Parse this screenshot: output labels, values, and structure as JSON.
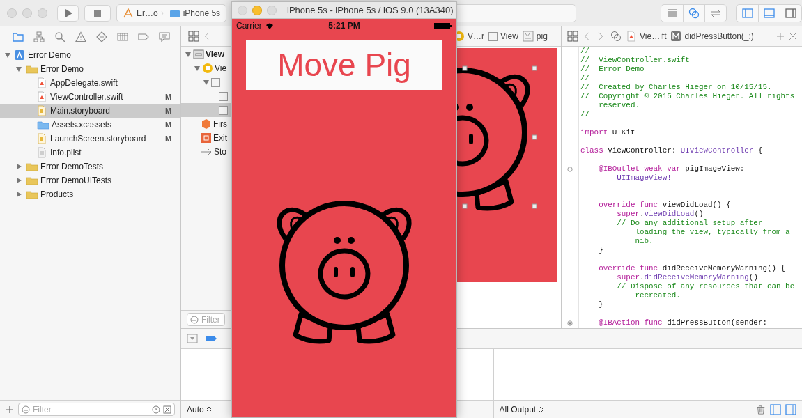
{
  "toolbar": {
    "scheme": {
      "project": "Er…o",
      "device": "iPhone 5s"
    }
  },
  "navigator": {
    "tabs": [
      {
        "kind": "folder",
        "selected": true
      },
      {
        "kind": "hierarchy",
        "selected": false
      },
      {
        "kind": "search",
        "selected": false
      },
      {
        "kind": "warning",
        "selected": false
      },
      {
        "kind": "diamond",
        "selected": false
      },
      {
        "kind": "table",
        "selected": false
      },
      {
        "kind": "tag",
        "selected": false
      },
      {
        "kind": "chat",
        "selected": false
      }
    ],
    "tree": [
      {
        "label": "Error Demo",
        "kind": "project",
        "expanded": true,
        "selected": false,
        "children": [
          {
            "label": "Error Demo",
            "kind": "folder",
            "expanded": true,
            "selected": false,
            "children": [
              {
                "label": "AppDelegate.swift",
                "kind": "swift",
                "selected": false
              },
              {
                "label": "ViewController.swift",
                "kind": "swift",
                "status": "M",
                "selected": false
              },
              {
                "label": "Main.storyboard",
                "kind": "storyboard",
                "status": "M",
                "selected": true
              },
              {
                "label": "Assets.xcassets",
                "kind": "assets",
                "status": "M",
                "selected": false
              },
              {
                "label": "LaunchScreen.storyboard",
                "kind": "storyboard",
                "status": "M",
                "selected": false
              },
              {
                "label": "Info.plist",
                "kind": "plist",
                "selected": false
              }
            ]
          },
          {
            "label": "Error DemoTests",
            "kind": "folder",
            "expanded": false,
            "selected": false
          },
          {
            "label": "Error DemoUITests",
            "kind": "folder",
            "expanded": false,
            "selected": false
          },
          {
            "label": "Products",
            "kind": "folder",
            "expanded": false,
            "selected": false
          }
        ]
      }
    ],
    "filter": {
      "placeholder": "Filter"
    }
  },
  "outline": {
    "items": [
      {
        "label": "View",
        "kind": "scene",
        "expanded": true,
        "selected": false,
        "children": [
          {
            "label": "Vie",
            "kind": "controller",
            "expanded": true,
            "selected": false,
            "children": [
              {
                "kind": "view",
                "expanded": true,
                "selected": false,
                "children": [
                  {
                    "kind": "view",
                    "selected": false
                  },
                  {
                    "kind": "view",
                    "selected": true
                  }
                ]
              }
            ]
          },
          {
            "label": "Firs",
            "kind": "cube",
            "selected": false
          },
          {
            "label": "Exit",
            "kind": "exit",
            "selected": false
          },
          {
            "label": "Sto",
            "kind": "arrow",
            "selected": false
          }
        ]
      }
    ],
    "filter": {
      "placeholder": "Filter"
    }
  },
  "ib_jump_bar": [
    {
      "label": "V…r",
      "kind": "controller"
    },
    {
      "label": "View",
      "kind": "view"
    },
    {
      "label": "pig",
      "kind": "image"
    }
  ],
  "code_jump_bar": [
    {
      "label": "Vie…ift",
      "kind": "swift"
    },
    {
      "label": "didPressButton(_:)",
      "kind": "method"
    }
  ],
  "code": [
    {
      "kind": "code",
      "parts": [
        {
          "kind": "comment",
          "text": "//"
        }
      ]
    },
    {
      "kind": "code",
      "parts": [
        {
          "kind": "comment",
          "text": "//  ViewController.swift"
        }
      ]
    },
    {
      "kind": "code",
      "parts": [
        {
          "kind": "comment",
          "text": "//  Error Demo"
        }
      ]
    },
    {
      "kind": "code",
      "parts": [
        {
          "kind": "comment",
          "text": "//"
        }
      ]
    },
    {
      "kind": "code",
      "parts": [
        {
          "kind": "comment",
          "text": "//  Created by Charles Hieger on 10/15/15."
        }
      ]
    },
    {
      "kind": "code",
      "parts": [
        {
          "kind": "comment",
          "text": "//  Copyright © 2015 Charles Hieger. All rights"
        }
      ]
    },
    {
      "kind": "code",
      "parts": [
        {
          "kind": "comment",
          "text": "    reserved."
        }
      ]
    },
    {
      "kind": "code",
      "parts": [
        {
          "kind": "comment",
          "text": "//"
        }
      ]
    },
    {
      "kind": "blank"
    },
    {
      "kind": "code",
      "parts": [
        {
          "kind": "keyword",
          "text": "import"
        },
        {
          "kind": "plain",
          "text": " UIKit"
        }
      ]
    },
    {
      "kind": "blank"
    },
    {
      "kind": "code",
      "parts": [
        {
          "kind": "keyword",
          "text": "class"
        },
        {
          "kind": "plain",
          "text": " ViewController: "
        },
        {
          "kind": "type",
          "text": "UIViewController"
        },
        {
          "kind": "plain",
          "text": " {"
        }
      ]
    },
    {
      "kind": "blank"
    },
    {
      "kind": "code",
      "connected": false,
      "parts": [
        {
          "kind": "keyword",
          "text": "    @IBOutlet weak var"
        },
        {
          "kind": "plain",
          "text": " pigImageView:"
        }
      ]
    },
    {
      "kind": "code",
      "parts": [
        {
          "kind": "type",
          "text": "        UIImageView!"
        }
      ]
    },
    {
      "kind": "blank"
    },
    {
      "kind": "blank"
    },
    {
      "kind": "code",
      "parts": [
        {
          "kind": "keyword",
          "text": "    override func"
        },
        {
          "kind": "plain",
          "text": " viewDidLoad() {"
        }
      ]
    },
    {
      "kind": "code",
      "parts": [
        {
          "kind": "keyword",
          "text": "        super"
        },
        {
          "kind": "plain",
          "text": "."
        },
        {
          "kind": "type",
          "text": "viewDidLoad"
        },
        {
          "kind": "plain",
          "text": "()"
        }
      ]
    },
    {
      "kind": "code",
      "parts": [
        {
          "kind": "comment",
          "text": "        // Do any additional setup after"
        }
      ]
    },
    {
      "kind": "code",
      "parts": [
        {
          "kind": "comment",
          "text": "            loading the view, typically from a"
        }
      ]
    },
    {
      "kind": "code",
      "parts": [
        {
          "kind": "comment",
          "text": "            nib."
        }
      ]
    },
    {
      "kind": "code",
      "parts": [
        {
          "kind": "plain",
          "text": "    }"
        }
      ]
    },
    {
      "kind": "blank"
    },
    {
      "kind": "code",
      "parts": [
        {
          "kind": "keyword",
          "text": "    override func"
        },
        {
          "kind": "plain",
          "text": " didReceiveMemoryWarning() {"
        }
      ]
    },
    {
      "kind": "code",
      "parts": [
        {
          "kind": "keyword",
          "text": "        super"
        },
        {
          "kind": "plain",
          "text": "."
        },
        {
          "kind": "type",
          "text": "didReceiveMemoryWarning"
        },
        {
          "kind": "plain",
          "text": "()"
        }
      ]
    },
    {
      "kind": "code",
      "parts": [
        {
          "kind": "comment",
          "text": "        // Dispose of any resources that can be"
        }
      ]
    },
    {
      "kind": "code",
      "parts": [
        {
          "kind": "comment",
          "text": "            recreated."
        }
      ]
    },
    {
      "kind": "code",
      "parts": [
        {
          "kind": "plain",
          "text": "    }"
        }
      ]
    },
    {
      "kind": "blank"
    },
    {
      "kind": "code",
      "connected": true,
      "parts": [
        {
          "kind": "keyword",
          "text": "    @IBAction func"
        },
        {
          "kind": "plain",
          "text": " didPressButton(sender:"
        }
      ]
    }
  ],
  "debug": {
    "variables_scope": "Auto",
    "console_scope": "All Output"
  },
  "simulator": {
    "title": "iPhone 5s - iPhone 5s / iOS 9.0 (13A340)",
    "carrier": "Carrier",
    "time": "5:21 PM",
    "label": "Move Pig"
  }
}
